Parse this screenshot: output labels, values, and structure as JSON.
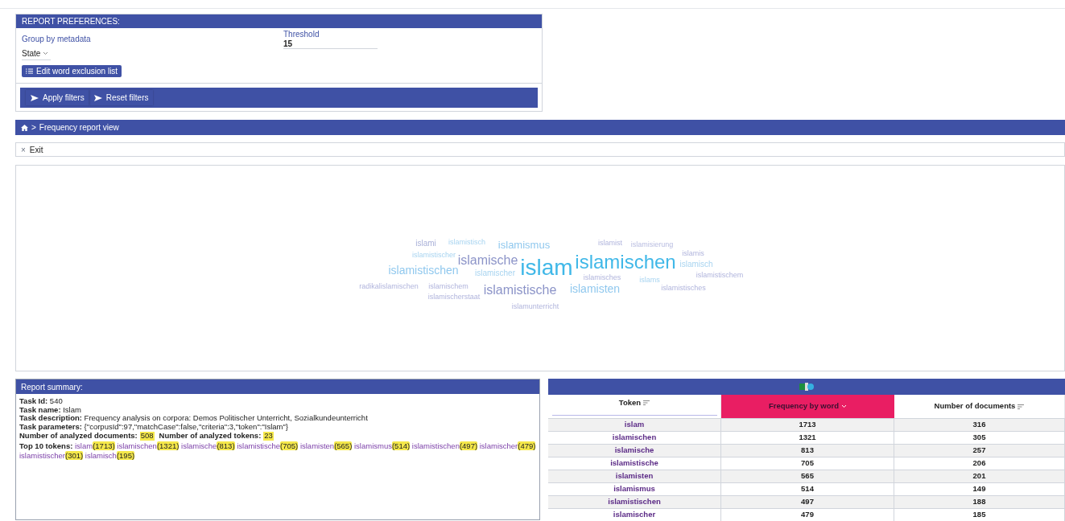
{
  "preferences": {
    "title": "REPORT PREFERENCES:",
    "group_label": "Group by metadata",
    "group_value": "State",
    "threshold_label": "Threshold",
    "threshold_value": "15",
    "exclusion_button": "Edit word exclusion list",
    "actions": [
      "Apply filters",
      "Reset filters"
    ]
  },
  "breadcrumb": {
    "separator": ">",
    "label": "Frequency report view"
  },
  "exit": {
    "icon": "×",
    "label": "Exit"
  },
  "word_cloud": [
    {
      "text": "islami",
      "color": "#a9b0d8"
    },
    {
      "text": "islamistisch",
      "color": "#a8d4f0"
    },
    {
      "text": "islamismus",
      "color": "#90c8ee"
    },
    {
      "text": "islamist",
      "color": "#b0b4dc"
    },
    {
      "text": "islamisierung",
      "color": "#b8bce0"
    },
    {
      "text": "islamistischer",
      "color": "#a8d4f0"
    },
    {
      "text": "islamische",
      "color": "#8c94c8"
    },
    {
      "text": "islam",
      "color": "#40b8e8"
    },
    {
      "text": "islamischen",
      "color": "#40b8e8"
    },
    {
      "text": "islamis",
      "color": "#b0b4dc"
    },
    {
      "text": "islamistischen",
      "color": "#90c8ee"
    },
    {
      "text": "islamischer",
      "color": "#a8d4f0"
    },
    {
      "text": "islamisch",
      "color": "#a8d4f0"
    },
    {
      "text": "islamisches",
      "color": "#b0b4dc"
    },
    {
      "text": "islams",
      "color": "#a8d4f0"
    },
    {
      "text": "islamistischem",
      "color": "#b0b4dc"
    },
    {
      "text": "radikalislamischen",
      "color": "#b0b4dc"
    },
    {
      "text": "islamischem",
      "color": "#b0b4dc"
    },
    {
      "text": "islamistische",
      "color": "#8c94c8"
    },
    {
      "text": "islamisten",
      "color": "#90c8ee"
    },
    {
      "text": "islamistisches",
      "color": "#b0b4dc"
    },
    {
      "text": "islamischerstaat",
      "color": "#b0b4dc"
    },
    {
      "text": "islamunterricht",
      "color": "#b0b4dc"
    }
  ],
  "summary": {
    "title": "Report summary:",
    "lines": [
      "**Task Id:** 540",
      "**Task name:** Islam",
      "**Task description:** Frequency analysis on corpora: Demos Politischer Unterricht, Sozialkundeunterricht",
      "**Task parameters:** {\"corpusId\":97,\"matchCase\":false,\"criteria\":3,\"token\":\"Islam\"}"
    ],
    "counts": [
      {
        "label": "Number of analyzed documents:",
        "value": "508"
      },
      {
        "label": "Number of analyzed tokens:",
        "value": "23"
      }
    ],
    "top_label": "Top 10 tokens:",
    "top_tokens": [
      {
        "token": "islam",
        "count": "(1713)"
      },
      {
        "token": "islamischen",
        "count": "(1321)"
      },
      {
        "token": "islamische",
        "count": "(813)"
      },
      {
        "token": "islamistische",
        "count": "(705)"
      },
      {
        "token": "islamisten",
        "count": "(565)"
      },
      {
        "token": "islamismus",
        "count": "(514)"
      },
      {
        "token": "islamistischen",
        "count": "(497)"
      },
      {
        "token": "islamischer",
        "count": "(479)"
      },
      {
        "token": "islamistischer",
        "count": "(301)"
      },
      {
        "token": "islamisch",
        "count": "(195)"
      }
    ]
  },
  "table": {
    "columns": [
      {
        "label": "Token",
        "selected": false,
        "filter": true
      },
      {
        "label": "Frequency by word",
        "selected": true,
        "filter": false
      },
      {
        "label": "Number of documents",
        "selected": false,
        "filter": false
      }
    ],
    "rows": [
      [
        "islam",
        "1713",
        "316"
      ],
      [
        "islamischen",
        "1321",
        "305"
      ],
      [
        "islamische",
        "813",
        "257"
      ],
      [
        "islamistische",
        "705",
        "206"
      ],
      [
        "islamisten",
        "565",
        "201"
      ],
      [
        "islamismus",
        "514",
        "149"
      ],
      [
        "islamistischen",
        "497",
        "188"
      ],
      [
        "islamischer",
        "479",
        "185"
      ]
    ]
  }
}
